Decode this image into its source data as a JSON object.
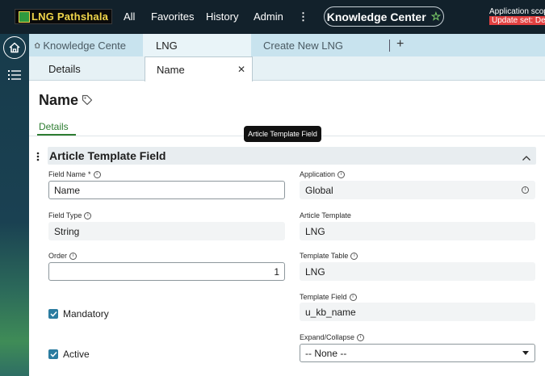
{
  "header": {
    "logo_text": "LNG Pathshala",
    "nav": [
      "All",
      "Favorites",
      "History",
      "Admin"
    ],
    "more": "⋮",
    "knowledge_center": "Knowledge Center",
    "app_scope": "Application scop",
    "update_set": "Update set: Def"
  },
  "tabs": [
    {
      "label": "Knowledge Cente",
      "active": false
    },
    {
      "label": "LNG",
      "active": true
    },
    {
      "label": "Create New LNG",
      "active": false
    }
  ],
  "subtabs": [
    {
      "label": "Details",
      "active": false
    },
    {
      "label": "Name",
      "active": true
    }
  ],
  "record": {
    "title": "Name",
    "section_tab": "Details",
    "tooltip": "Article Template Field",
    "section_title": "Article Template Field"
  },
  "fields": {
    "field_name": {
      "label": "Field Name",
      "required": "*",
      "value": "Name"
    },
    "field_type": {
      "label": "Field Type",
      "value": "String"
    },
    "order": {
      "label": "Order",
      "value": "1"
    },
    "mandatory": {
      "label": "Mandatory",
      "checked": true
    },
    "active": {
      "label": "Active",
      "checked": true
    },
    "application": {
      "label": "Application",
      "value": "Global"
    },
    "article_template": {
      "label": "Article Template",
      "value": "LNG"
    },
    "template_table": {
      "label": "Template Table",
      "value": "LNG"
    },
    "template_field": {
      "label": "Template Field",
      "value": "u_kb_name"
    },
    "expand_collapse": {
      "label": "Expand/Collapse",
      "value": "-- None --"
    }
  },
  "icons": {
    "home": "home-icon",
    "list": "list-icon",
    "star": "star-icon",
    "tag": "tag-icon",
    "info": "info-icon"
  },
  "colors": {
    "header_bg": "#12212b",
    "tab_bg": "#c8e3ee",
    "accent_green": "#2e7d32",
    "checkbox": "#2b7ca0",
    "update_set_bg": "#e24141"
  }
}
